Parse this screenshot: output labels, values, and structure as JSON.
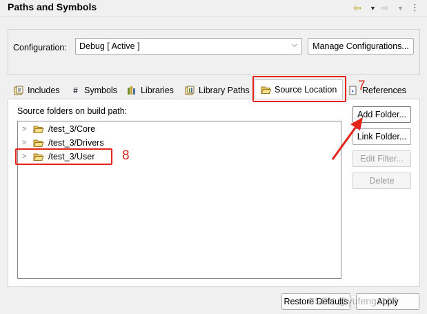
{
  "header": {
    "title": "Paths and Symbols",
    "back_icon": "back-arrow-icon",
    "forward_icon": "forward-arrow-icon"
  },
  "configuration": {
    "label": "Configuration:",
    "selected": "Debug  [ Active ]",
    "manage_button": "Manage Configurations..."
  },
  "tabs": [
    {
      "label": "Includes",
      "icon": "includes-icon"
    },
    {
      "label": "Symbols",
      "icon": "hash-icon"
    },
    {
      "label": "Libraries",
      "icon": "libraries-icon"
    },
    {
      "label": "Library Paths",
      "icon": "library-paths-icon"
    },
    {
      "label": "Source Location",
      "icon": "folder-icon",
      "active": true
    },
    {
      "label": "References",
      "icon": "references-icon"
    }
  ],
  "source_location": {
    "list_label": "Source folders on build path:",
    "folders": [
      {
        "name": "/test_3/Core"
      },
      {
        "name": "/test_3/Drivers"
      },
      {
        "name": "/test_3/User"
      }
    ],
    "buttons": {
      "add_folder": "Add Folder...",
      "link_folder": "Link Folder...",
      "edit_filter": "Edit Filter...",
      "delete": "Delete"
    }
  },
  "annotations": {
    "tab_marker": "7",
    "folder_marker": "8",
    "color": "#e4231b"
  },
  "footer": {
    "restore_defaults": "Restore Defaults",
    "apply": "Apply",
    "watermark": "CSDN @yufeng1108"
  }
}
